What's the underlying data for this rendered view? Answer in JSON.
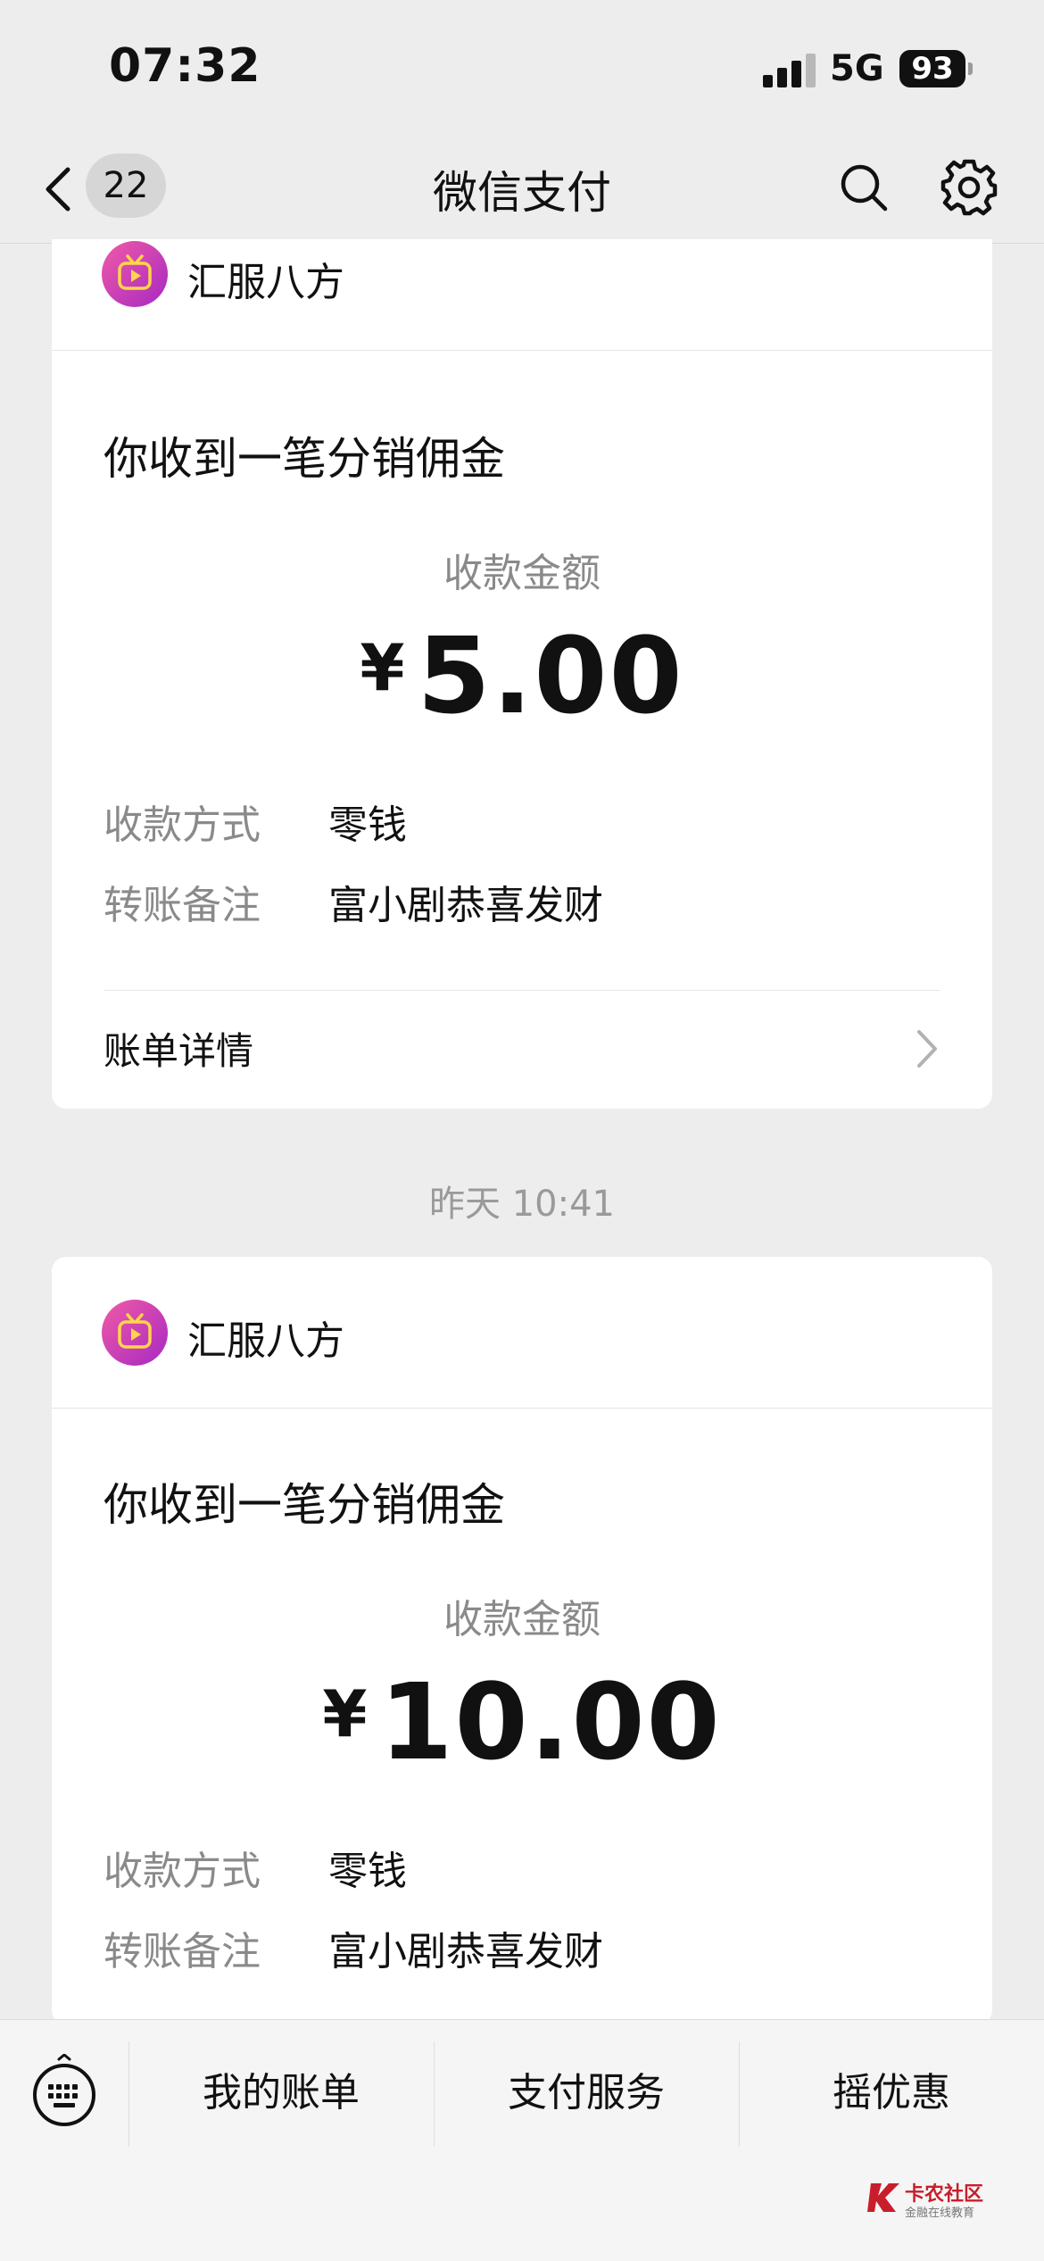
{
  "status_bar": {
    "time": "07:32",
    "network": "5G",
    "battery": "93"
  },
  "nav": {
    "back_badge": "22",
    "title": "微信支付"
  },
  "cards": [
    {
      "app_name": "汇服八方",
      "message_title": "你收到一笔分销佣金",
      "amount_label": "收款金额",
      "currency": "¥",
      "amount": "5.00",
      "method_label": "收款方式",
      "method_value": "零钱",
      "remark_label": "转账备注",
      "remark_value": "富小剧恭喜发财",
      "detail_label": "账单详情"
    },
    {
      "app_name": "汇服八方",
      "message_title": "你收到一笔分销佣金",
      "amount_label": "收款金额",
      "currency": "¥",
      "amount": "10.00",
      "method_label": "收款方式",
      "method_value": "零钱",
      "remark_label": "转账备注",
      "remark_value": "富小剧恭喜发财"
    }
  ],
  "timestamp": "昨天 10:41",
  "bottom_menu": [
    "我的账单",
    "支付服务",
    "摇优惠"
  ],
  "watermark": {
    "title": "卡农社区",
    "subtitle": "金融在线教育"
  },
  "colors": {
    "background": "#ededed",
    "card": "#ffffff",
    "app_icon": "#d93fb2",
    "watermark": "#c81e2b"
  }
}
